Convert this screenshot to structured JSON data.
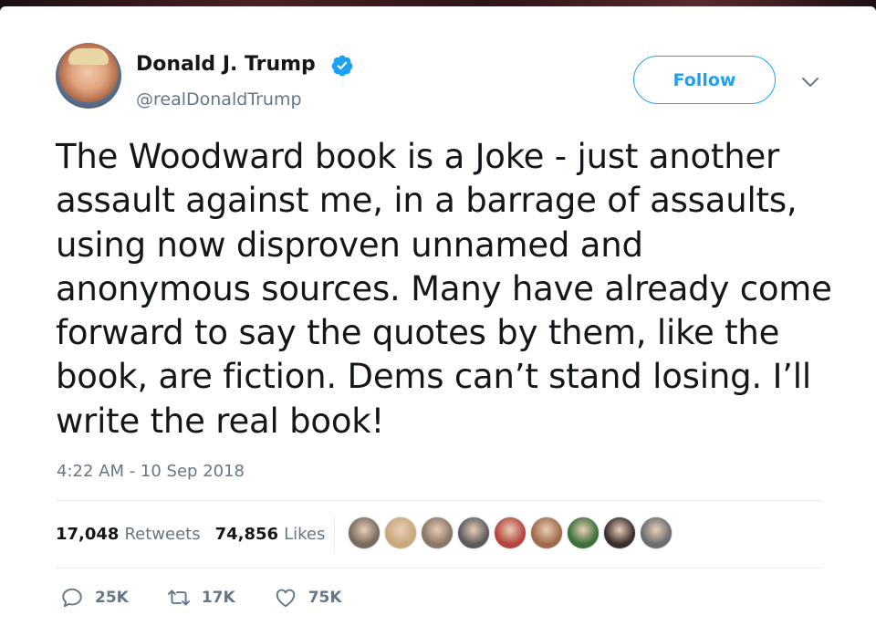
{
  "author": {
    "name": "Donald J. Trump",
    "handle": "@realDonaldTrump",
    "verified": true
  },
  "follow_label": "Follow",
  "tweet": {
    "lines": [
      "The Woodward book is a Joke - just another",
      "assault against me, in a barrage of assaults,",
      "using now disproven unnamed and",
      "anonymous sources. Many have already come",
      "forward to say the quotes by them, like the",
      "book, are fiction. Dems can’t stand losing. I’ll",
      "write the real book!"
    ],
    "timestamp": "4:22 AM - 10 Sep 2018"
  },
  "stats": {
    "retweets_count": "17,048",
    "retweets_label": "Retweets",
    "likes_count": "74,856",
    "likes_label": "Likes"
  },
  "likers": [
    {
      "color": "#7a6a5c"
    },
    {
      "color": "#c9a87a"
    },
    {
      "color": "#8a7666"
    },
    {
      "color": "#5d5a5a"
    },
    {
      "color": "#b5443d"
    },
    {
      "color": "#a26a4a"
    },
    {
      "color": "#3c6f3a"
    },
    {
      "color": "#3a2f2c"
    },
    {
      "color": "#6b6d70"
    }
  ],
  "actions": {
    "reply_count": "25K",
    "retweet_count": "17K",
    "like_count": "75K"
  },
  "colors": {
    "accent": "#1da1f2",
    "text": "#14171a",
    "secondary": "#657786"
  }
}
